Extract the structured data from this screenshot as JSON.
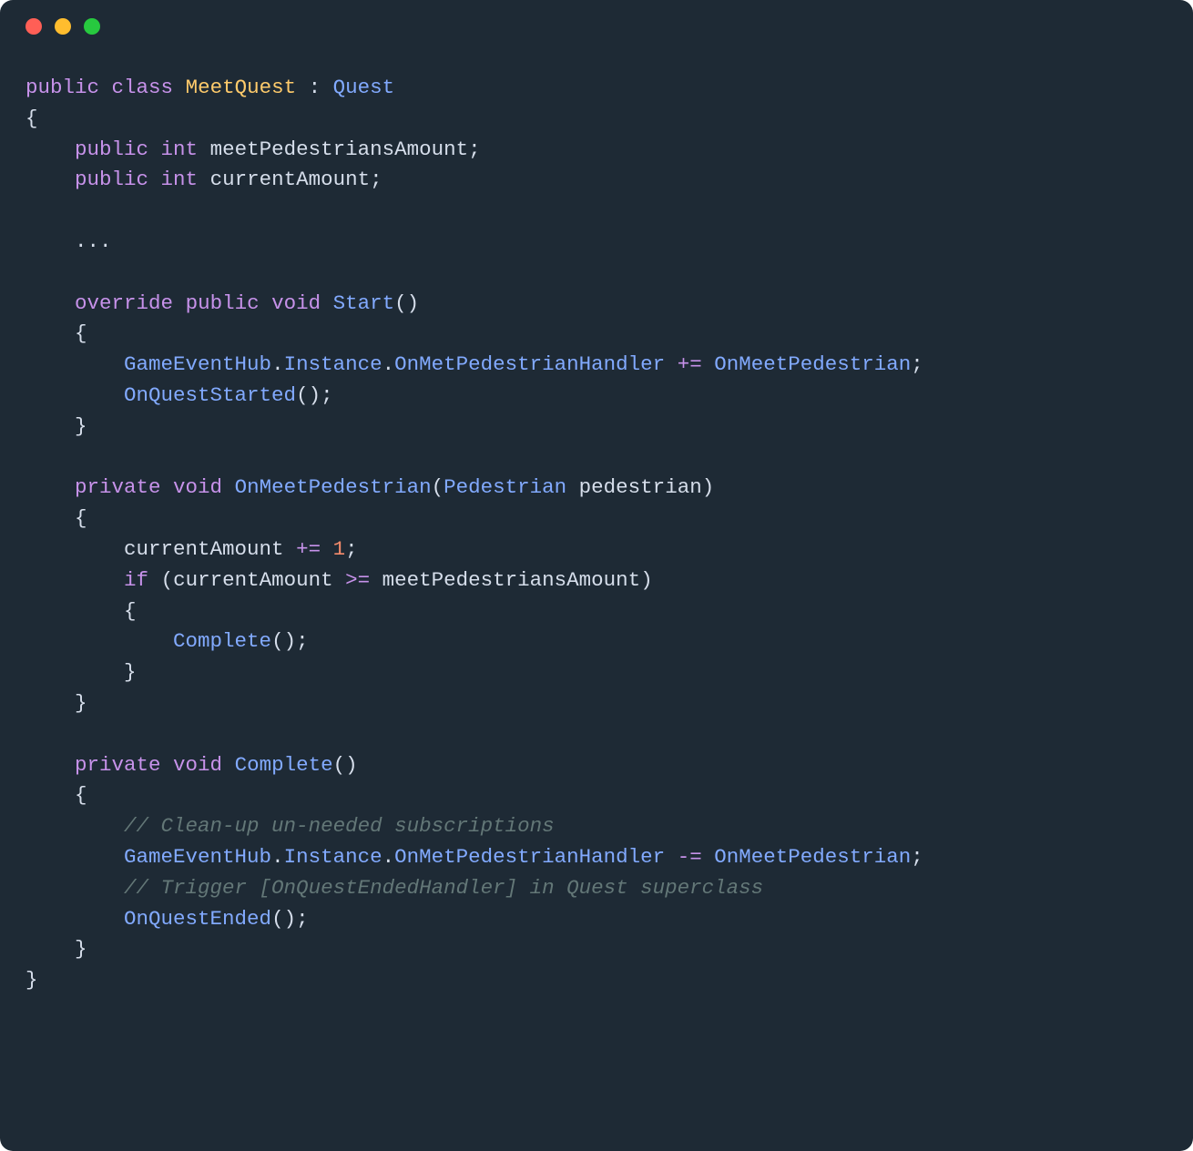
{
  "colors": {
    "background": "#1e2a35",
    "keyword": "#c792ea",
    "type": "#ffcb6b",
    "classRef": "#82aaff",
    "identifier": "#d6deeb",
    "number": "#f78c6c",
    "comment": "#637777"
  },
  "code": {
    "line1": {
      "kw_public": "public",
      "kw_class": "class",
      "cls_name": "MeetQuest",
      "colon": " : ",
      "base": "Quest"
    },
    "line2": {
      "brace": "{"
    },
    "line3": {
      "indent": "    ",
      "kw_public": "public",
      "sp": " ",
      "type_int": "int",
      "name": " meetPedestriansAmount",
      "semi": ";"
    },
    "line4": {
      "indent": "    ",
      "kw_public": "public",
      "sp": " ",
      "type_int": "int",
      "name": " currentAmount",
      "semi": ";"
    },
    "line5": {
      "blank": ""
    },
    "line6": {
      "indent": "    ",
      "dots": "..."
    },
    "line7": {
      "blank": ""
    },
    "line8": {
      "indent": "    ",
      "kw_override": "override",
      "sp1": " ",
      "kw_public": "public",
      "sp2": " ",
      "kw_void": "void",
      "sp3": " ",
      "method": "Start",
      "parens": "()"
    },
    "line9": {
      "indent": "    ",
      "brace": "{"
    },
    "line10": {
      "indent": "        ",
      "obj1": "GameEventHub",
      "dot1": ".",
      "prop1": "Instance",
      "dot2": ".",
      "prop2": "OnMetPedestrianHandler",
      "sp_op": " ",
      "op": "+=",
      "sp2": " ",
      "handler": "OnMeetPedestrian",
      "semi": ";"
    },
    "line11": {
      "indent": "        ",
      "method": "OnQuestStarted",
      "parens": "()",
      "semi": ";"
    },
    "line12": {
      "indent": "    ",
      "brace": "}"
    },
    "line13": {
      "blank": ""
    },
    "line14": {
      "indent": "    ",
      "kw_private": "private",
      "sp1": " ",
      "kw_void": "void",
      "sp2": " ",
      "method": "OnMeetPedestrian",
      "paren_open": "(",
      "ptype": "Pedestrian",
      "pname": " pedestrian",
      "paren_close": ")"
    },
    "line15": {
      "indent": "    ",
      "brace": "{"
    },
    "line16": {
      "indent": "        ",
      "lhs": "currentAmount ",
      "op": "+=",
      "sp": " ",
      "num": "1",
      "semi": ";"
    },
    "line17": {
      "indent": "        ",
      "kw_if": "if",
      "sp": " ",
      "paren_open": "(",
      "a": "currentAmount ",
      "cmp": ">=",
      "b": " meetPedestriansAmount",
      "paren_close": ")"
    },
    "line18": {
      "indent": "        ",
      "brace": "{"
    },
    "line19": {
      "indent": "            ",
      "method": "Complete",
      "parens": "()",
      "semi": ";"
    },
    "line20": {
      "indent": "        ",
      "brace": "}"
    },
    "line21": {
      "indent": "    ",
      "brace": "}"
    },
    "line22": {
      "blank": ""
    },
    "line23": {
      "indent": "    ",
      "kw_private": "private",
      "sp1": " ",
      "kw_void": "void",
      "sp2": " ",
      "method": "Complete",
      "parens": "()"
    },
    "line24": {
      "indent": "    ",
      "brace": "{"
    },
    "line25": {
      "indent": "        ",
      "comment": "// Clean-up un-needed subscriptions"
    },
    "line26": {
      "indent": "        ",
      "obj1": "GameEventHub",
      "dot1": ".",
      "prop1": "Instance",
      "dot2": ".",
      "prop2": "OnMetPedestrianHandler",
      "sp_op": " ",
      "op": "-=",
      "sp2": " ",
      "handler": "OnMeetPedestrian",
      "semi": ";"
    },
    "line27": {
      "indent": "        ",
      "comment": "// Trigger [OnQuestEndedHandler] in Quest superclass"
    },
    "line28": {
      "indent": "        ",
      "method": "OnQuestEnded",
      "parens": "()",
      "semi": ";"
    },
    "line29": {
      "indent": "    ",
      "brace": "}"
    },
    "line30": {
      "brace": "}"
    }
  }
}
